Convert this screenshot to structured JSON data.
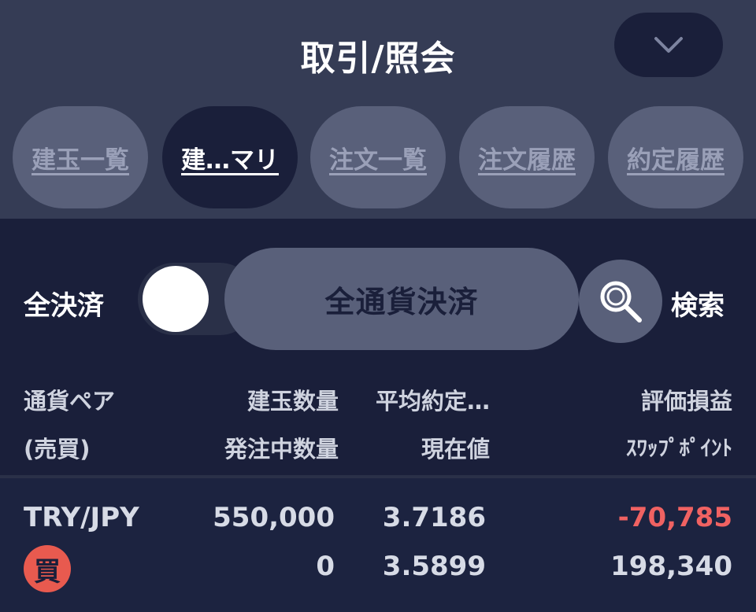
{
  "header": {
    "title": "取引/照会",
    "collapse_icon": "chevron-down-icon"
  },
  "tabs": [
    {
      "label": "建玉一覧",
      "active": false
    },
    {
      "label": "建…マリ",
      "active": true
    },
    {
      "label": "注文一覧",
      "active": false
    },
    {
      "label": "注文履歴",
      "active": false
    },
    {
      "label": "約定履歴",
      "active": false
    }
  ],
  "actions": {
    "all_close_label": "全決済",
    "all_close_toggle": "on",
    "all_currency_settle_label": "全通貨決済",
    "search_icon": "search-icon",
    "search_label": "検索"
  },
  "columns": {
    "pair": "通貨ペア",
    "side": "(売買)",
    "position_qty": "建玉数量",
    "pending_qty": "発注中数量",
    "avg_price": "平均約定…",
    "current_price": "現在値",
    "pnl": "評価損益",
    "swap": "ｽﾜｯﾌﾟﾎﾟｲﾝﾄ"
  },
  "rows": [
    {
      "pair": "TRY/JPY",
      "side": "買",
      "position_qty": "550,000",
      "pending_qty": "0",
      "avg_price": "3.7186",
      "current_price": "3.5899",
      "pnl": "-70,785",
      "swap": "198,340"
    }
  ],
  "colors": {
    "header_bg": "#353c55",
    "body_bg": "#1a1f3a",
    "pill_bg": "#59607a",
    "negative": "#f06262",
    "buy_badge": "#e85a4f"
  }
}
